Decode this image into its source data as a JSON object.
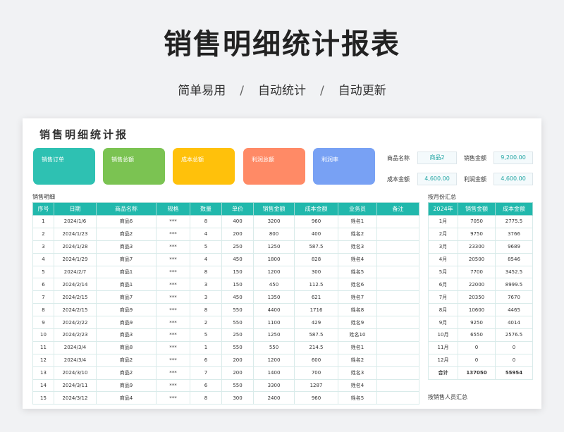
{
  "hero": {
    "title": "销售明细统计报表",
    "tags": [
      "简单易用",
      "自动统计",
      "自动更新"
    ],
    "separator": "/"
  },
  "sheet": {
    "title": "销售明细统计报",
    "kpis": [
      {
        "label": "销售订单",
        "color": "#2ec1b2"
      },
      {
        "label": "销售总额",
        "color": "#7bc352"
      },
      {
        "label": "成本总额",
        "color": "#ffc10b"
      },
      {
        "label": "利润总额",
        "color": "#ff8a66"
      },
      {
        "label": "利润率",
        "color": "#78a1f4"
      }
    ],
    "lookup": {
      "product_label": "商品名称",
      "product_value": "商品2",
      "sales_label": "销售金额",
      "sales_value": "9,200.00",
      "cost_label": "成本金额",
      "cost_value": "4,600.00",
      "profit_label": "利润金额",
      "profit_value": "4,600.00"
    },
    "detail": {
      "label": "销售明细",
      "headers": [
        "序号",
        "日期",
        "商品名称",
        "规格",
        "数量",
        "单价",
        "销售金额",
        "成本金额",
        "业务员",
        "备注"
      ],
      "rows": [
        [
          "1",
          "2024/1/6",
          "商品6",
          "***",
          "8",
          "400",
          "3200",
          "960",
          "姓名1",
          ""
        ],
        [
          "2",
          "2024/1/23",
          "商品2",
          "***",
          "4",
          "200",
          "800",
          "400",
          "姓名2",
          ""
        ],
        [
          "3",
          "2024/1/28",
          "商品3",
          "***",
          "5",
          "250",
          "1250",
          "587.5",
          "姓名3",
          ""
        ],
        [
          "4",
          "2024/1/29",
          "商品7",
          "***",
          "4",
          "450",
          "1800",
          "828",
          "姓名4",
          ""
        ],
        [
          "5",
          "2024/2/7",
          "商品1",
          "***",
          "8",
          "150",
          "1200",
          "300",
          "姓名5",
          ""
        ],
        [
          "6",
          "2024/2/14",
          "商品1",
          "***",
          "3",
          "150",
          "450",
          "112.5",
          "姓名6",
          ""
        ],
        [
          "7",
          "2024/2/15",
          "商品7",
          "***",
          "3",
          "450",
          "1350",
          "621",
          "姓名7",
          ""
        ],
        [
          "8",
          "2024/2/15",
          "商品9",
          "***",
          "8",
          "550",
          "4400",
          "1716",
          "姓名8",
          ""
        ],
        [
          "9",
          "2024/2/22",
          "商品9",
          "***",
          "2",
          "550",
          "1100",
          "429",
          "姓名9",
          ""
        ],
        [
          "10",
          "2024/2/23",
          "商品3",
          "***",
          "5",
          "250",
          "1250",
          "587.5",
          "姓名10",
          ""
        ],
        [
          "11",
          "2024/3/4",
          "商品8",
          "***",
          "1",
          "550",
          "550",
          "214.5",
          "姓名1",
          ""
        ],
        [
          "12",
          "2024/3/4",
          "商品2",
          "***",
          "6",
          "200",
          "1200",
          "600",
          "姓名2",
          ""
        ],
        [
          "13",
          "2024/3/10",
          "商品2",
          "***",
          "7",
          "200",
          "1400",
          "700",
          "姓名3",
          ""
        ],
        [
          "14",
          "2024/3/11",
          "商品9",
          "***",
          "6",
          "550",
          "3300",
          "1287",
          "姓名4",
          ""
        ],
        [
          "15",
          "2024/3/12",
          "商品4",
          "***",
          "8",
          "300",
          "2400",
          "960",
          "姓名5",
          ""
        ]
      ]
    },
    "monthly": {
      "label": "按月份汇总",
      "headers": [
        "2024年",
        "销售金额",
        "成本金额"
      ],
      "rows": [
        [
          "1月",
          "7050",
          "2775.5"
        ],
        [
          "2月",
          "9750",
          "3766"
        ],
        [
          "3月",
          "23300",
          "9689"
        ],
        [
          "4月",
          "20500",
          "8546"
        ],
        [
          "5月",
          "7700",
          "3452.5"
        ],
        [
          "6月",
          "22000",
          "8999.5"
        ],
        [
          "7月",
          "20350",
          "7670"
        ],
        [
          "8月",
          "10600",
          "4465"
        ],
        [
          "9月",
          "9250",
          "4014"
        ],
        [
          "10月",
          "6550",
          "2576.5"
        ],
        [
          "11月",
          "0",
          "0"
        ],
        [
          "12月",
          "0",
          "0"
        ]
      ],
      "total": [
        "合计",
        "137050",
        "55954"
      ]
    },
    "by_person_label": "按销售人员汇总"
  }
}
